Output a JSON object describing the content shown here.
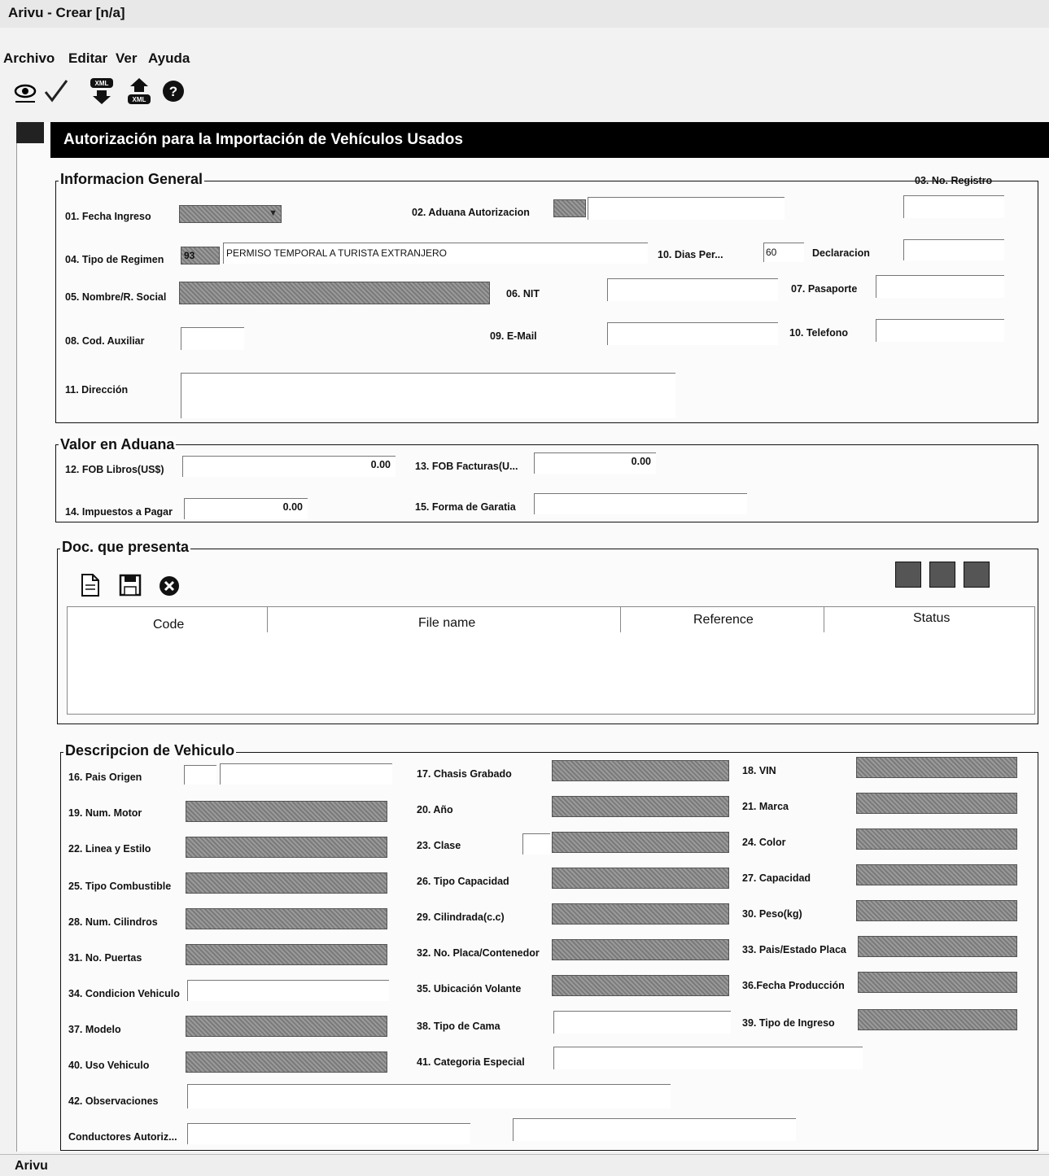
{
  "window": {
    "title": "Arivu - Crear [n/a]"
  },
  "menu": [
    "Archivo",
    "Editar",
    "Ver",
    "Ayuda"
  ],
  "toolbar": {
    "icons": [
      "eye-icon",
      "check-icon",
      "xml-download-icon",
      "xml-upload-icon",
      "help-icon"
    ],
    "xml_label": "XML"
  },
  "form": {
    "title": "Autorización para la Importación de Vehículos Usados"
  },
  "general": {
    "legend": "Informacion General",
    "fecha_label": "01. Fecha Ingreso",
    "aduana_label": "02. Aduana Autorizacion",
    "registro_label": "03. No. Registro",
    "regimen_label": "04. Tipo de Regimen",
    "regimen_code": "93",
    "regimen_value": "PERMISO TEMPORAL A TURISTA EXTRANJERO",
    "dias_label": "10. Dias Per...",
    "dias_value": "60",
    "declaracion_label": "Declaracion",
    "nombre_label": "05. Nombre/R. Social",
    "nit_label": "06. NIT",
    "pasaporte_label": "07. Pasaporte",
    "auxiliar_label": "08. Cod. Auxiliar",
    "email_label": "09. E-Mail",
    "telefono_label": "10. Telefono",
    "direccion_label": "11. Dirección"
  },
  "valor": {
    "legend": "Valor en Aduana",
    "fob_libros_label": "12. FOB Libros(US$)",
    "fob_libros_value": "0.00",
    "fob_facturas_label": "13. FOB Facturas(U...",
    "fob_facturas_value": "0.00",
    "impuestos_label": "14. Impuestos a Pagar",
    "impuestos_value": "0.00",
    "garantia_label": "15. Forma de Garatia"
  },
  "docs": {
    "legend": "Doc. que presenta",
    "columns": [
      "Code",
      "File name",
      "Reference",
      "Status"
    ]
  },
  "vehiculo": {
    "legend": "Descripcion de Vehiculo",
    "col1": [
      "16. Pais Origen",
      "19. Num. Motor",
      "22. Linea y Estilo",
      "25. Tipo Combustible",
      "28. Num. Cilindros",
      "31. No. Puertas",
      "34. Condicion Vehiculo",
      "37. Modelo",
      "40. Uso Vehiculo",
      "42. Observaciones",
      "Conductores Autoriz..."
    ],
    "col2": [
      "17. Chasis Grabado",
      "20. Año",
      "23. Clase",
      "26. Tipo Capacidad",
      "29. Cilindrada(c.c)",
      "32. No. Placa/Contenedor",
      "35. Ubicación Volante",
      "38. Tipo de Cama",
      "41. Categoria Especial"
    ],
    "col3": [
      "18. VIN",
      "21. Marca",
      "24. Color",
      "27. Capacidad",
      "30. Peso(kg)",
      "33. Pais/Estado Placa",
      "36.Fecha Producción",
      "39. Tipo de Ingreso"
    ]
  },
  "status": {
    "text": "Arivu"
  }
}
